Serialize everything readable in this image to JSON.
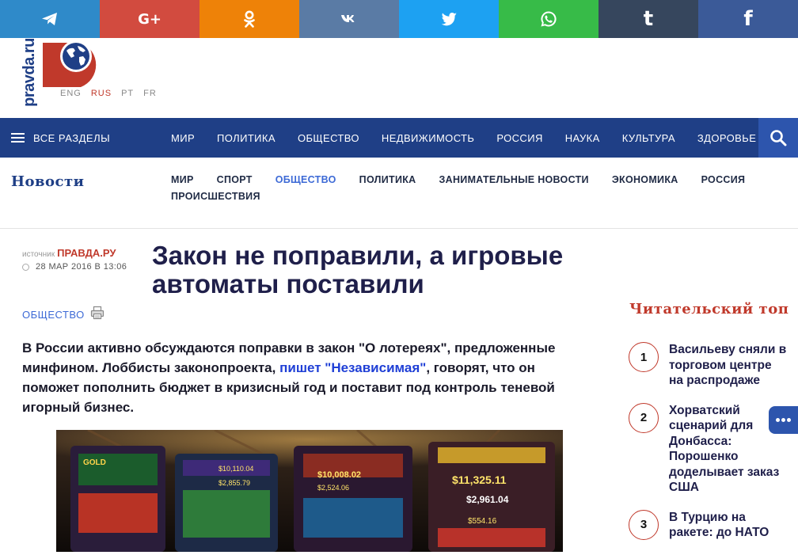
{
  "share": [
    {
      "name": "telegram",
      "color": "#2f8ac9",
      "icon": "telegram-icon",
      "glyph": ""
    },
    {
      "name": "google-plus",
      "color": "#d24b3f",
      "icon": "google-plus-icon",
      "glyph": "G+"
    },
    {
      "name": "odnoklassniki",
      "color": "#ee8208",
      "icon": "odnoklassniki-icon",
      "glyph": ""
    },
    {
      "name": "vkontakte",
      "color": "#5a7ba5",
      "icon": "vk-icon",
      "glyph": ""
    },
    {
      "name": "twitter",
      "color": "#1da1f2",
      "icon": "twitter-icon",
      "glyph": ""
    },
    {
      "name": "whatsapp",
      "color": "#37bb48",
      "icon": "whatsapp-icon",
      "glyph": ""
    },
    {
      "name": "tumblr",
      "color": "#36465d",
      "icon": "tumblr-icon",
      "glyph": "t"
    },
    {
      "name": "facebook",
      "color": "#3b5a98",
      "icon": "facebook-icon",
      "glyph": "f"
    }
  ],
  "logo": {
    "text": "pravda.ru"
  },
  "languages": {
    "eng": "ENG",
    "rus": "RUS",
    "pt": "PT",
    "fr": "FR"
  },
  "main_nav": {
    "all_sections": "ВСЕ РАЗДЕЛЫ",
    "items": [
      "МИР",
      "ПОЛИТИКА",
      "ОБЩЕСТВО",
      "НЕДВИЖИМОСТЬ",
      "РОССИЯ",
      "НАУКА",
      "КУЛЬТУРА",
      "ЗДОРОВЬЕ"
    ]
  },
  "news": {
    "title": "Новости",
    "items": [
      "МИР",
      "СПОРТ",
      "ОБЩЕСТВО",
      "ПОЛИТИКА",
      "ЗАНИМАТЕЛЬНЫЕ НОВОСТИ",
      "ЭКОНОМИКА",
      "РОССИЯ",
      "ПРОИСШЕСТВИЯ"
    ],
    "active": "ОБЩЕСТВО"
  },
  "article": {
    "source_label": "источник",
    "source_name": "ПРАВДА.РУ",
    "date": "28 МАР 2016 В 13:06",
    "category": "ОБЩЕСТВО",
    "headline": "Закон не поправили, а игровые автоматы поставили",
    "lead_before": "В России активно обсуждаются поправки в закон \"О лотереях\", предложенные минфином. Лоббисты законопроекта, ",
    "lead_link": "пишет \"Независимая\"",
    "lead_after": ", говорят, что он поможет пополнить бюджет в кризисный год и поставит под контроль теневой игорный бизнес.",
    "image_alt": "slot machines",
    "slot_labels": [
      "GOLD",
      "$10,110.04",
      "$2,855.79",
      "$10,008.02",
      "$2,524.06",
      "$11,325.11",
      "$2,961.04",
      "$554.16"
    ]
  },
  "reader_top": {
    "title": "Читательский топ",
    "items": [
      {
        "num": "1",
        "text": "Васильеву сняли в торговом центре на распродаже"
      },
      {
        "num": "2",
        "text": "Хорватский сценарий для Донбасса: Порошенко доделывает заказ США"
      },
      {
        "num": "3",
        "text": "В Турцию на ракете: до НАТО"
      }
    ]
  }
}
